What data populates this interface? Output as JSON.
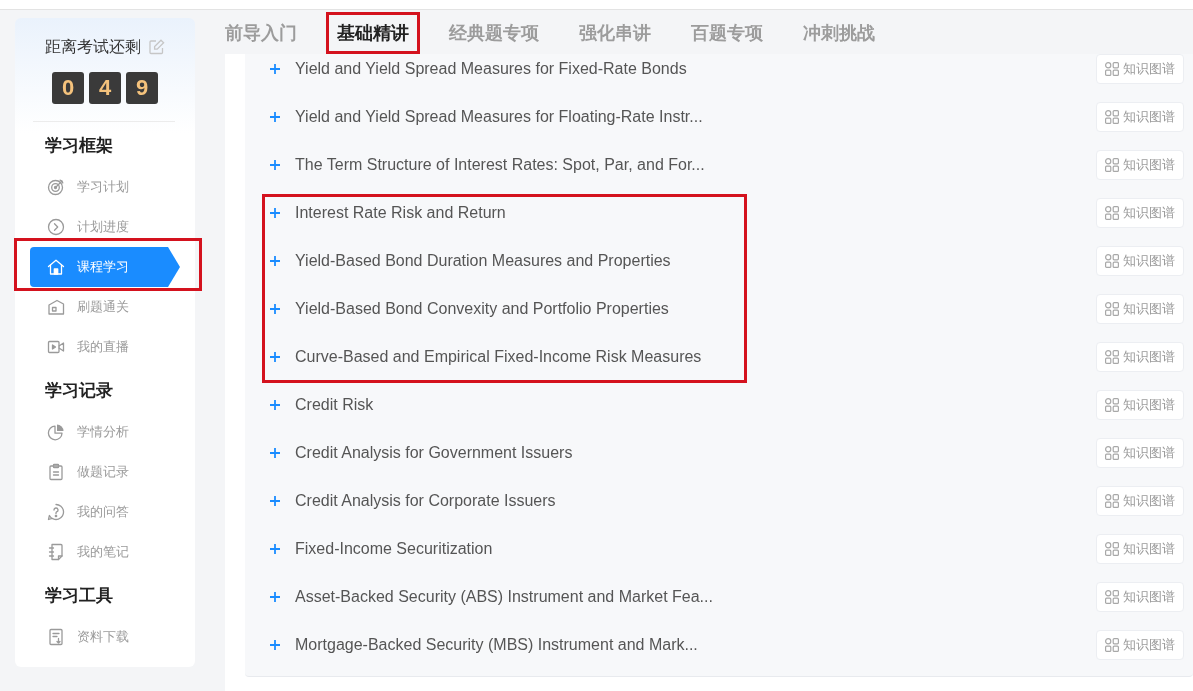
{
  "sidebar": {
    "countdown": {
      "label": "距离考试还剩",
      "digits": [
        "0",
        "4",
        "9"
      ]
    },
    "sections": [
      {
        "title": "学习框架",
        "items": [
          {
            "label": "学习计划",
            "selected": false,
            "highlighted": false
          },
          {
            "label": "计划进度",
            "selected": false,
            "highlighted": false
          },
          {
            "label": "课程学习",
            "selected": true,
            "highlighted": true
          },
          {
            "label": "刷题通关",
            "selected": false,
            "highlighted": false
          },
          {
            "label": "我的直播",
            "selected": false,
            "highlighted": false
          }
        ]
      },
      {
        "title": "学习记录",
        "items": [
          {
            "label": "学情分析",
            "selected": false,
            "highlighted": false
          },
          {
            "label": "做题记录",
            "selected": false,
            "highlighted": false
          },
          {
            "label": "我的问答",
            "selected": false,
            "highlighted": false
          },
          {
            "label": "我的笔记",
            "selected": false,
            "highlighted": false
          }
        ]
      },
      {
        "title": "学习工具",
        "items": [
          {
            "label": "资料下载",
            "selected": false,
            "highlighted": false
          }
        ]
      }
    ]
  },
  "tabs": [
    {
      "label": "前导入门",
      "selected": false,
      "highlighted": false
    },
    {
      "label": "基础精讲",
      "selected": true,
      "highlighted": true
    },
    {
      "label": "经典题专项",
      "selected": false,
      "highlighted": false
    },
    {
      "label": "强化串讲",
      "selected": false,
      "highlighted": false
    },
    {
      "label": "百题专项",
      "selected": false,
      "highlighted": false
    },
    {
      "label": "冲刺挑战",
      "selected": false,
      "highlighted": false
    }
  ],
  "lessons": [
    {
      "title": "Yield and Yield Spread Measures for Fixed-Rate Bonds",
      "highlighted": false,
      "button": "知识图谱"
    },
    {
      "title": "Yield and Yield Spread Measures for Floating-Rate Instr...",
      "highlighted": false,
      "button": "知识图谱"
    },
    {
      "title": "The Term Structure of Interest Rates: Spot, Par, and For...",
      "highlighted": false,
      "button": "知识图谱"
    },
    {
      "title": "Interest Rate Risk and Return",
      "highlighted": true,
      "button": "知识图谱"
    },
    {
      "title": "Yield-Based Bond Duration Measures and Properties",
      "highlighted": true,
      "button": "知识图谱"
    },
    {
      "title": "Yield-Based Bond Convexity and Portfolio Properties",
      "highlighted": true,
      "button": "知识图谱"
    },
    {
      "title": "Curve-Based and Empirical Fixed-Income Risk Measures",
      "highlighted": true,
      "button": "知识图谱"
    },
    {
      "title": "Credit Risk",
      "highlighted": false,
      "button": "知识图谱"
    },
    {
      "title": "Credit Analysis for Government Issuers",
      "highlighted": false,
      "button": "知识图谱"
    },
    {
      "title": "Credit Analysis for Corporate Issuers",
      "highlighted": false,
      "button": "知识图谱"
    },
    {
      "title": "Fixed-Income Securitization",
      "highlighted": false,
      "button": "知识图谱"
    },
    {
      "title": "Asset-Backed Security (ABS) Instrument and Market Fea...",
      "highlighted": false,
      "button": "知识图谱"
    },
    {
      "title": "Mortgage-Backed Security (MBS) Instrument and Mark...",
      "highlighted": false,
      "button": "知识图谱"
    }
  ]
}
